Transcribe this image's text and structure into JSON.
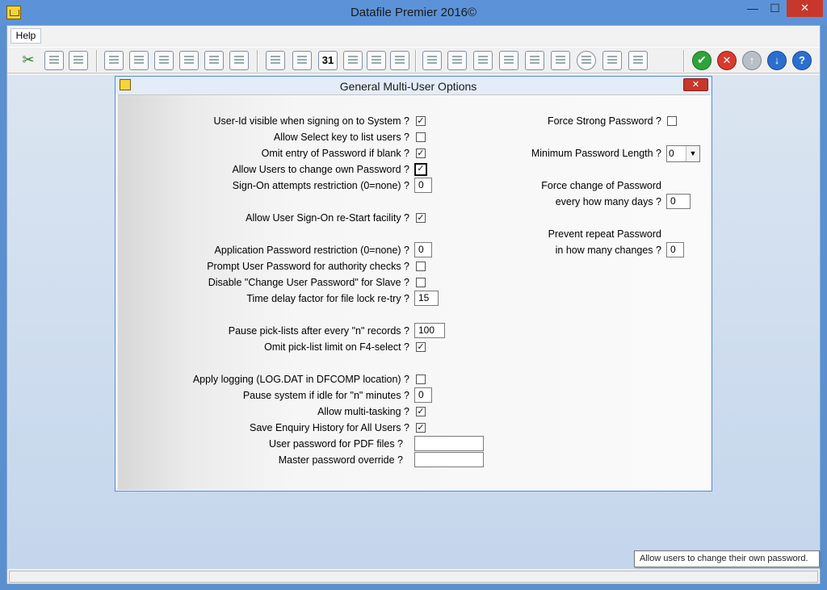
{
  "window": {
    "title": "Datafile  Premier 2016©",
    "min_glyph": "—",
    "max_glyph": "☐",
    "close_glyph": "✕"
  },
  "menu": {
    "help_label": "Help"
  },
  "toolbar": {
    "calendar_label": "31",
    "ok_glyph": "✔",
    "cancel_glyph": "✕",
    "up_glyph": "↑",
    "down_glyph": "↓",
    "help_glyph": "?",
    "cut_glyph": "✂"
  },
  "dialog": {
    "title": "General Multi-User Options",
    "close_glyph": "✕",
    "check_glyph": "✓",
    "left": {
      "userid_visible": {
        "label": "User-Id visible when signing on to System ?",
        "checked": true
      },
      "allow_select_key": {
        "label": "Allow Select key to list users ?",
        "checked": false
      },
      "omit_password_blank": {
        "label": "Omit entry of Password if blank ?",
        "checked": true
      },
      "allow_change_own_password": {
        "label": "Allow Users to change own Password ?",
        "checked": true
      },
      "signon_attempts": {
        "label": "Sign-On attempts restriction (0=none) ?",
        "value": "0"
      },
      "allow_restart": {
        "label": "Allow User Sign-On re-Start facility ?",
        "checked": true
      },
      "app_password_restriction": {
        "label": "Application Password restriction (0=none) ?",
        "value": "0"
      },
      "prompt_user_password": {
        "label": "Prompt User Password for authority checks ?",
        "checked": false
      },
      "disable_change_password": {
        "label": "Disable \"Change User Password\" for Slave ?",
        "checked": false
      },
      "time_delay": {
        "label": "Time delay factor for file lock re-try ?",
        "value": "15"
      },
      "pause_picklists": {
        "label": "Pause pick-lists after every \"n\" records ?",
        "value": "100"
      },
      "omit_picklist_limit": {
        "label": "Omit pick-list limit on F4-select ?",
        "checked": true
      },
      "apply_logging": {
        "label": "Apply logging (LOG.DAT in DFCOMP location) ?",
        "checked": false
      },
      "pause_idle": {
        "label": "Pause system if idle for \"n\" minutes ?",
        "value": "0"
      },
      "allow_multitasking": {
        "label": "Allow multi-tasking ?",
        "checked": true
      },
      "save_enquiry_history": {
        "label": "Save Enquiry History for All Users ?",
        "checked": true
      },
      "pdf_password": {
        "label": "User password for PDF files ?",
        "value": ""
      },
      "master_password": {
        "label": "Master password override ?",
        "value": ""
      }
    },
    "right": {
      "force_strong_password": {
        "label": "Force Strong Password ?",
        "checked": false
      },
      "min_password_length": {
        "label": "Minimum Password Length ?",
        "value": "0",
        "arrow": "▼"
      },
      "force_change_line1": "Force change of Password",
      "force_change_line2": "every how many days ?",
      "force_change_days": "0",
      "prevent_repeat_line1": "Prevent repeat Password",
      "prevent_repeat_line2": "in how many changes ?",
      "prevent_repeat_changes": "0"
    }
  },
  "tooltip": "Allow users to change their own password.",
  "colors": {
    "title_bar": "#5c93d8",
    "close_red": "#c7372b",
    "content_bg": "#c4d6ec"
  }
}
